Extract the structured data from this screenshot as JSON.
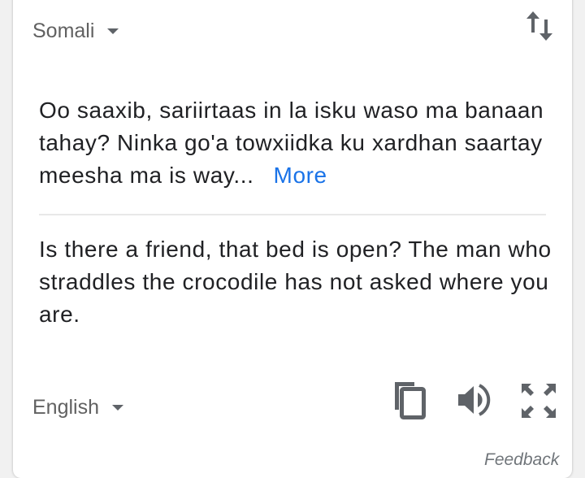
{
  "source": {
    "language": "Somali",
    "text": "Oo saaxib, sariirtaas in la isku waso ma banaan tahay? Ninka go'a towxiidka ku xardhan saartay meesha ma is way...",
    "more_label": "More"
  },
  "translation": {
    "language": "English",
    "text": "Is there a friend, that bed is open? The man who straddles the crocodile has not asked where you are."
  },
  "icons": {
    "swap": "swap-languages-icon",
    "copy": "copy-icon",
    "speak": "volume-icon",
    "expand": "fullscreen-icon"
  },
  "footer": {
    "feedback_label": "Feedback"
  }
}
